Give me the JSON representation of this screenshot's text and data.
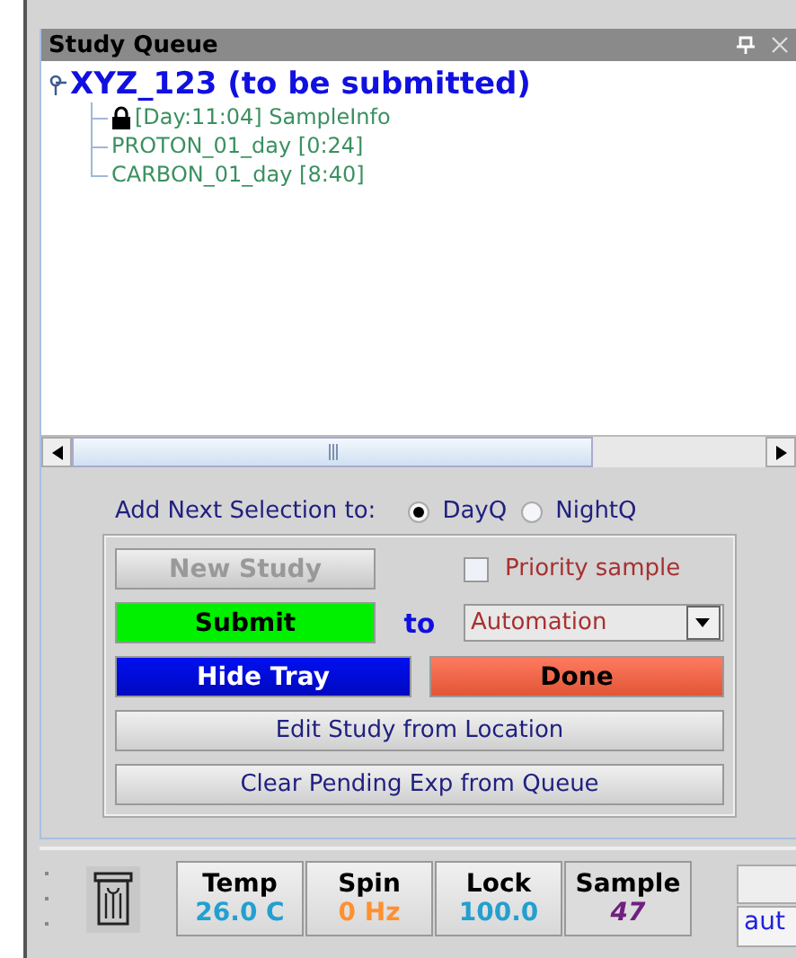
{
  "panel": {
    "title": "Study Queue"
  },
  "tree": {
    "label": "XYZ_123 (to be submitted)",
    "children": [
      {
        "label": "[Day:11:04] SampleInfo",
        "locked": true
      },
      {
        "label": "PROTON_01_day [0:24]",
        "locked": false
      },
      {
        "label": "CARBON_01_day [8:40]",
        "locked": false
      }
    ]
  },
  "add_next": {
    "label": "Add Next Selection to:",
    "options": [
      {
        "label": "DayQ",
        "selected": true
      },
      {
        "label": "NightQ",
        "selected": false
      }
    ]
  },
  "new_study": {
    "label": "New Study",
    "disabled": true
  },
  "priority": {
    "label": "Priority sample",
    "checked": false
  },
  "submit": {
    "label": "Submit",
    "to_label": "to",
    "dropdown": "Automation"
  },
  "actions": [
    {
      "label": "Hide Tray",
      "kind": "blue"
    },
    {
      "label": "Done",
      "kind": "red"
    }
  ],
  "wide_buttons": [
    "Edit Study from Location",
    "Clear Pending Exp from Queue"
  ],
  "status": [
    {
      "label": "Temp",
      "value": "26.0 C",
      "color": "#22a0d0",
      "selected": false
    },
    {
      "label": "Spin",
      "value": "0 Hz",
      "color": "#ff9030",
      "selected": false
    },
    {
      "label": "Lock",
      "value": "100.0",
      "color": "#22a0d0",
      "selected": false
    },
    {
      "label": "Sample",
      "value": "47",
      "color": "#702080",
      "selected": true
    }
  ],
  "side_field": "aut"
}
